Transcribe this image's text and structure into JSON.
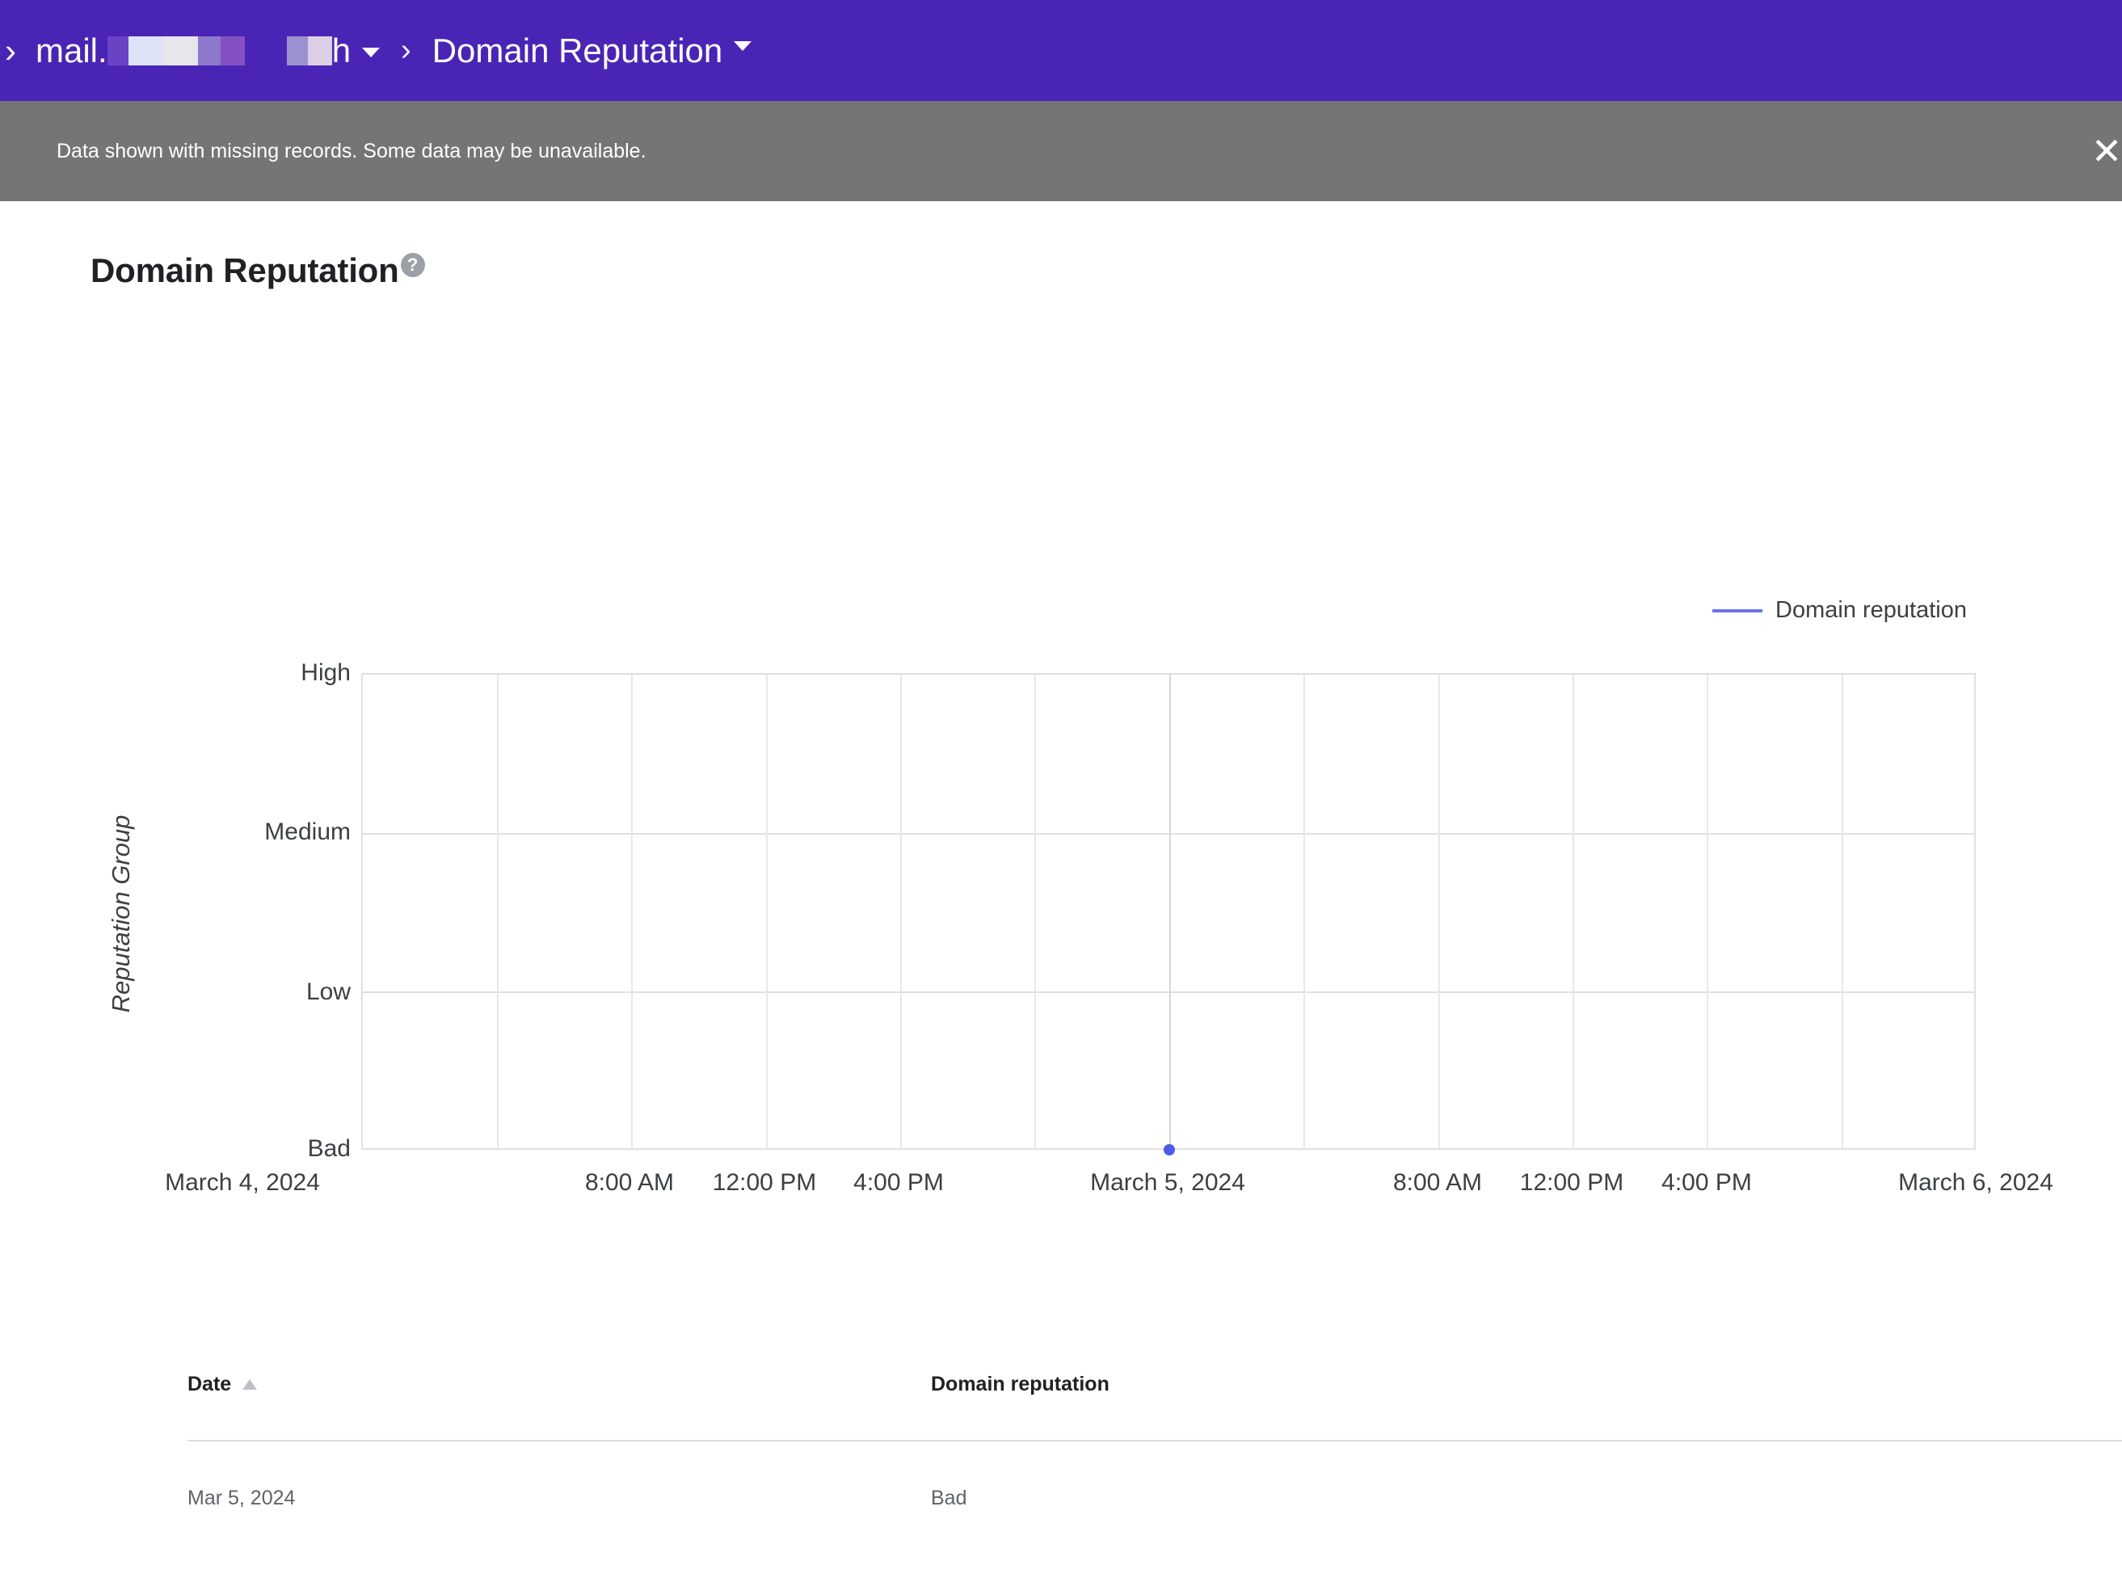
{
  "appbar": {
    "lead_chevron": "›",
    "domain_prefix": "mail.",
    "domain_suffix": "h",
    "domain_caret_icon": "caret-down-icon",
    "separator": "›",
    "current_page": "Domain Reputation",
    "current_caret_icon": "caret-down-icon",
    "background_color": "#4A25B5"
  },
  "banner": {
    "message": "Data shown with missing records. Some data may be unavailable.",
    "close_icon": "✕",
    "background_color": "#757575"
  },
  "header": {
    "title": "Domain Reputation",
    "help_icon": "?"
  },
  "chart_data": {
    "type": "line",
    "title": "Domain Reputation",
    "xlabel": "",
    "ylabel": "Reputation Group",
    "legend": [
      {
        "name": "Domain reputation",
        "color": "#6874E8"
      }
    ],
    "legend_position": "top-right",
    "grid": true,
    "y_categories": [
      "Bad",
      "Low",
      "Medium",
      "High"
    ],
    "y_ticks": [
      "High",
      "Medium",
      "Low",
      "Bad"
    ],
    "ylim": [
      0,
      3
    ],
    "x_ticks": [
      {
        "label": "March 4, 2024",
        "pos": 0.0
      },
      {
        "label": "8:00 AM",
        "pos": 0.3333
      },
      {
        "label": "12:00 PM",
        "pos": 0.4166
      },
      {
        "label": "4:00 PM",
        "pos": 0.5
      },
      {
        "label": "March 5, 2024",
        "pos": 0.6666
      },
      {
        "label": "8:00 AM",
        "pos": 0.8333
      },
      {
        "label": "12:00 PM",
        "pos": 0.9166
      },
      {
        "label": "4:00 PM",
        "pos": 1.0
      },
      {
        "label": "March 6, 2024",
        "pos": 1.0
      }
    ],
    "x_range": [
      "March 4, 2024",
      "March 6, 2024"
    ],
    "series": [
      {
        "name": "Domain reputation",
        "color": "#4F5BE8",
        "points": [
          {
            "x": "Mar 5, 2024",
            "y": "Bad",
            "y_value": 0
          }
        ]
      }
    ]
  },
  "table": {
    "columns": [
      {
        "key": "date",
        "label": "Date",
        "sort": "ascending",
        "sort_icon": "sort-ascending-icon"
      },
      {
        "key": "reputation",
        "label": "Domain reputation"
      }
    ],
    "rows": [
      {
        "date": "Mar 5, 2024",
        "reputation": "Bad"
      }
    ]
  }
}
